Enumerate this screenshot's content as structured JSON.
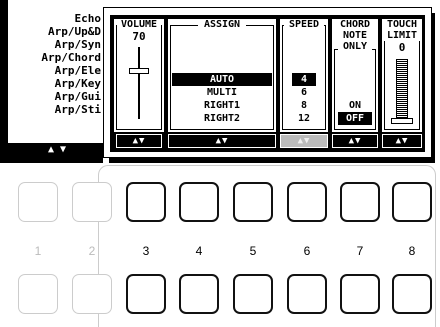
{
  "background_list": {
    "items": [
      "Echo",
      "Arp/Up&D",
      "Arp/Syn",
      "Arp/Chord",
      "Arp/Ele",
      "Arp/Key",
      "Arp/Gui",
      "Arp/Sti"
    ],
    "button_label": "▲ ▼"
  },
  "popup": {
    "volume": {
      "label": "VOLUME",
      "value": "70",
      "level": 0.7,
      "buttons": "▲▼"
    },
    "assign": {
      "label": "ASSIGN",
      "options": [
        "AUTO",
        "MULTI",
        "RIGHT1",
        "RIGHT2"
      ],
      "selected": "AUTO",
      "buttons": "▲▼"
    },
    "speed": {
      "label": "SPEED",
      "options": [
        "4",
        "6",
        "8",
        "12"
      ],
      "selected": "4",
      "buttons": "▲▼"
    },
    "chord_note_only": {
      "label_lines": [
        "CHORD",
        "NOTE",
        "ONLY"
      ],
      "options": [
        "ON",
        "OFF"
      ],
      "selected": "OFF",
      "buttons": "▲▼"
    },
    "touch_limit": {
      "label_lines": [
        "TOUCH",
        "LIMIT"
      ],
      "value": "0",
      "level": 0,
      "buttons": "▲▼"
    }
  },
  "panel_buttons": {
    "numbers": [
      "1",
      "2",
      "3",
      "4",
      "5",
      "6",
      "7",
      "8"
    ]
  }
}
